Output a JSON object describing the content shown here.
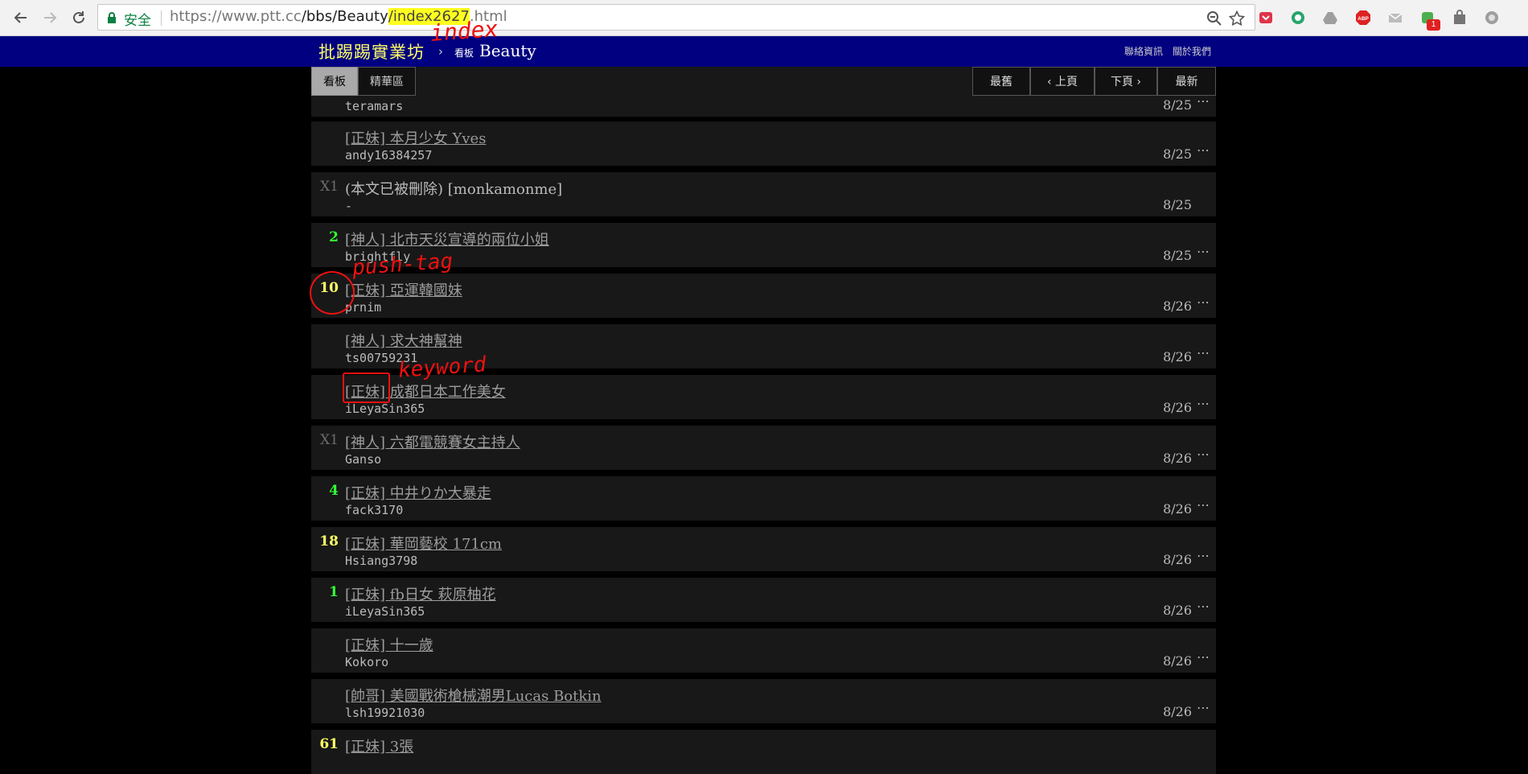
{
  "browser": {
    "secure_label": "安全",
    "url_prefix": "https://www.ptt.cc",
    "url_path": "/bbs/Beauty",
    "url_highlight": "/index2627",
    "url_suffix": ".html",
    "extension_badge": "1",
    "extension_abp": "ABP"
  },
  "header": {
    "site_title": "批踢踢實業坊",
    "breadcrumb_arrow": "›",
    "breadcrumb_label": "看板",
    "board_name": "Beauty",
    "links": [
      "聯絡資訊",
      "關於我們"
    ]
  },
  "actionbar": {
    "tabs": [
      "看板",
      "精華區"
    ],
    "pager": [
      "最舊",
      "‹ 上頁",
      "下頁 ›",
      "最新"
    ]
  },
  "posts": [
    {
      "nrec": "",
      "nrec_color": "",
      "title": "",
      "author": "teramars",
      "date": "8/25",
      "more": "⋯",
      "deleted": false
    },
    {
      "nrec": "",
      "nrec_color": "",
      "title": "[正妹] 本月少女 Yves",
      "author": "andy16384257",
      "date": "8/25",
      "more": "⋯",
      "deleted": false
    },
    {
      "nrec": "X1",
      "nrec_color": "x",
      "title": "(本文已被刪除) [monkamonme]",
      "author": "-",
      "date": "8/25",
      "more": "",
      "deleted": true
    },
    {
      "nrec": "2",
      "nrec_color": "green",
      "title": "[神人] 北市天災宣導的兩位小姐",
      "author": "brightfly",
      "date": "8/25",
      "more": "⋯",
      "deleted": false
    },
    {
      "nrec": "10",
      "nrec_color": "yellow",
      "title": "[正妹] 亞運韓國妹",
      "author": "prnim",
      "date": "8/26",
      "more": "⋯",
      "deleted": false
    },
    {
      "nrec": "",
      "nrec_color": "",
      "title": "[神人] 求大神幫神",
      "author": "ts00759231",
      "date": "8/26",
      "more": "⋯",
      "deleted": false
    },
    {
      "nrec": "",
      "nrec_color": "",
      "title": "[正妹] 成都日本工作美女",
      "author": "iLeyaSin365",
      "date": "8/26",
      "more": "⋯",
      "deleted": false
    },
    {
      "nrec": "X1",
      "nrec_color": "x",
      "title": "[神人] 六都電競賽女主持人",
      "author": "Ganso",
      "date": "8/26",
      "more": "⋯",
      "deleted": false
    },
    {
      "nrec": "4",
      "nrec_color": "green",
      "title": "[正妹] 中井りか大暴走",
      "author": "fack3170",
      "date": "8/26",
      "more": "⋯",
      "deleted": false
    },
    {
      "nrec": "18",
      "nrec_color": "yellow",
      "title": "[正妹] 華岡藝校 171cm",
      "author": "Hsiang3798",
      "date": "8/26",
      "more": "⋯",
      "deleted": false
    },
    {
      "nrec": "1",
      "nrec_color": "green",
      "title": "[正妹] fb日女 萩原柚花",
      "author": "iLeyaSin365",
      "date": "8/26",
      "more": "⋯",
      "deleted": false
    },
    {
      "nrec": "",
      "nrec_color": "",
      "title": "[正妹] 十一歲",
      "author": "Kokoro",
      "date": "8/26",
      "more": "⋯",
      "deleted": false
    },
    {
      "nrec": "",
      "nrec_color": "",
      "title": "[帥哥] 美國戰術槍械潮男Lucas Botkin",
      "author": "lsh19921030",
      "date": "8/26",
      "more": "⋯",
      "deleted": false
    },
    {
      "nrec": "61",
      "nrec_color": "yellow",
      "title": "[正妹] 3張",
      "author": "",
      "date": "",
      "more": "",
      "deleted": false
    }
  ],
  "annotations": {
    "index": "index",
    "push_tag": "push-tag",
    "keyword": "keyword"
  },
  "colors": {
    "header_bg": "#000080",
    "site_title": "#ffff66",
    "push_green": "#33ff33",
    "push_yellow": "#ffff66",
    "annotation_red": "#ee1111",
    "url_highlight": "#ffff1f"
  }
}
